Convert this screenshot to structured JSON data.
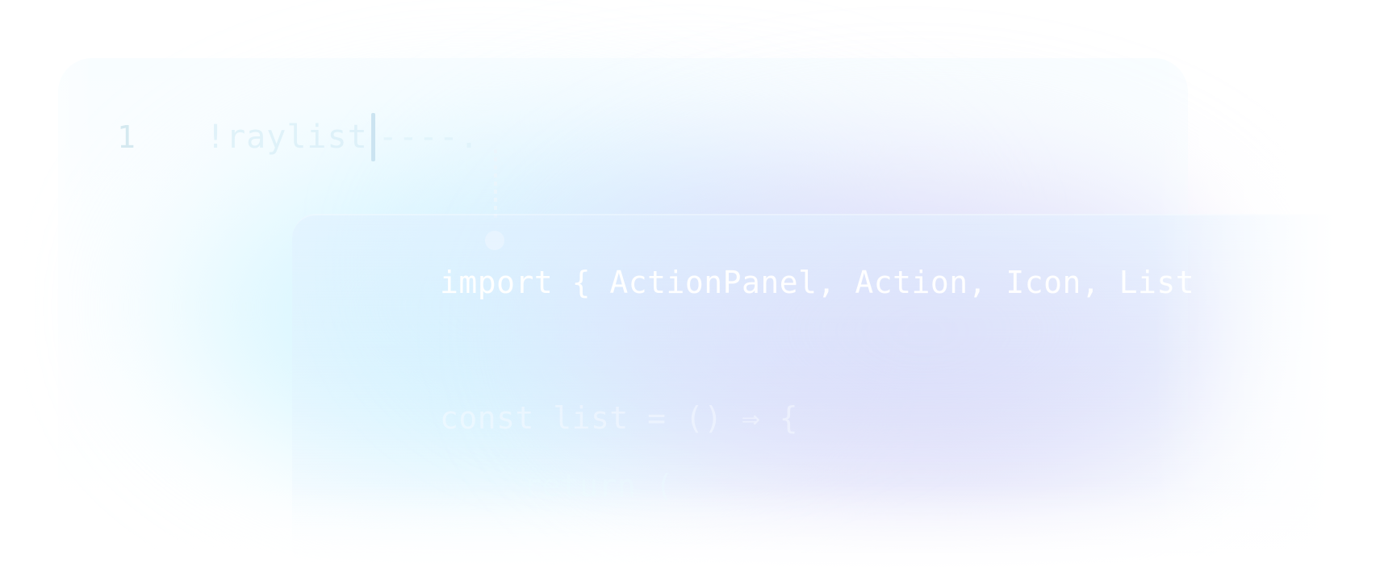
{
  "editor": {
    "line_number": "1",
    "typed_text": "!raylist",
    "ghost_text": "----."
  },
  "snippet": {
    "lines": [
      "import { ActionPanel, Action, Icon, List",
      "const list = () ⇒ {",
      "return ("
    ]
  },
  "colors": {
    "glow_cyan": "#bef0ff",
    "glow_violet": "#cdc8f5",
    "code_primary": "#ffffff"
  }
}
